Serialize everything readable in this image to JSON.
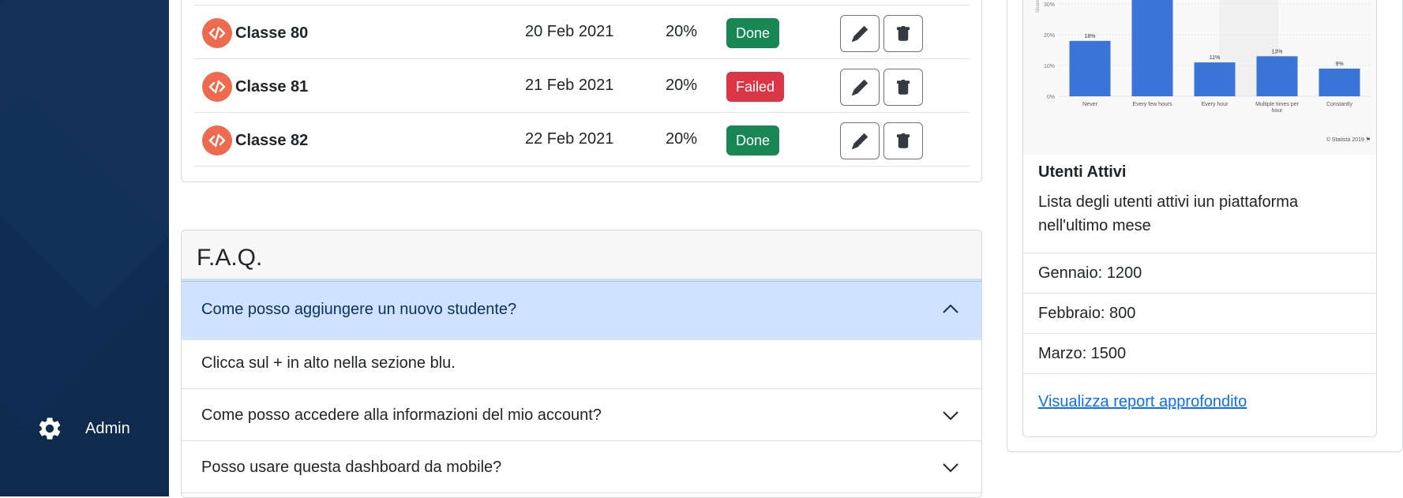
{
  "sidebar": {
    "admin_label": "Admin"
  },
  "classes": [
    {
      "name": "Classe 80",
      "date": "20 Feb 2021",
      "percent": "20%",
      "status": "Done"
    },
    {
      "name": "Classe 81",
      "date": "21 Feb 2021",
      "percent": "20%",
      "status": "Failed"
    },
    {
      "name": "Classe 82",
      "date": "22 Feb 2021",
      "percent": "20%",
      "status": "Done"
    }
  ],
  "faq": {
    "title": "F.A.Q.",
    "items": [
      {
        "question": "Come posso aggiungere un nuovo studente?",
        "answer": "Clicca sul + in alto nella sezione blu."
      },
      {
        "question": "Come posso accedere alla informazioni del mio account?"
      },
      {
        "question": "Posso usare questa dashboard da mobile?"
      }
    ]
  },
  "side_card": {
    "title": "Utenti Attivi",
    "text": "Lista degli utenti attivi iun piattaforma nell'ultimo mese",
    "list": [
      "Gennaio: 1200",
      "Febbraio: 800",
      "Marzo: 1500"
    ],
    "link": "Visualizza report approfondito"
  },
  "chart_data": {
    "type": "bar",
    "categories": [
      "Never",
      "Every few hours",
      "Every hour",
      "Multiple times per hour",
      "Constantly"
    ],
    "values": [
      18,
      36,
      11,
      13,
      9
    ],
    "data_labels": [
      "18%",
      "",
      "11%",
      "13%",
      "9%"
    ],
    "ylabel": "Share of resp",
    "yticks": [
      "0%",
      "10%",
      "20%",
      "30%"
    ],
    "ylim": [
      0,
      35
    ],
    "source": "© Statista 2019 ⚑",
    "color": "#3a74d6"
  },
  "colors": {
    "done": "#198754",
    "failed": "#dc3545",
    "accent": "#0d6efd"
  }
}
